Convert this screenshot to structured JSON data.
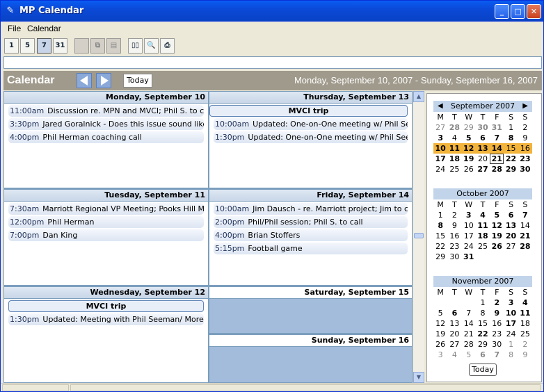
{
  "window": {
    "title": "MP Calendar"
  },
  "menu": [
    "File",
    "Calendar"
  ],
  "toolbar": {
    "view_buttons": [
      "1",
      "5",
      "7",
      "31"
    ]
  },
  "calendar": {
    "heading": "Calendar",
    "today_label": "Today",
    "range": "Monday, September 10, 2007 - Sunday, September 16, 2007"
  },
  "days": [
    {
      "header": "Monday, September 10",
      "events": [
        {
          "time": "11:00am",
          "text": "Discussion re. MPN and MVCI; Phil S. to call"
        },
        {
          "time": "3:30pm",
          "text": "Jared Goralnick - Does this issue sound like s"
        },
        {
          "time": "4:00pm",
          "text": "Phil Herman coaching call"
        }
      ]
    },
    {
      "header": "Tuesday, September 11",
      "events": [
        {
          "time": "7:30am",
          "text": "Marriott Regional VP Meeting; Pooks Hill Ma"
        },
        {
          "time": "12:00pm",
          "text": "Phil Herman"
        },
        {
          "time": "7:00pm",
          "text": "Dan King"
        }
      ]
    },
    {
      "header": "Wednesday, September 12",
      "allday": "MVCI trip",
      "events": [
        {
          "time": "1:30pm",
          "text": "Updated: Meeting with Phil Seeman/ More P"
        }
      ]
    },
    {
      "header": "Thursday, September 13",
      "allday": "MVCI trip",
      "events": [
        {
          "time": "10:00am",
          "text": "Updated: One-on-One meeting w/ Phil Seer"
        },
        {
          "time": "1:30pm",
          "text": "Updated: One-on-One meeting w/ Phil Seem"
        }
      ]
    },
    {
      "header": "Friday, September 14",
      "events": [
        {
          "time": "10:00am",
          "text": "Jim Dausch - re. Marriott project; Jim to call"
        },
        {
          "time": "2:00pm",
          "text": "Phil/Phil session; Phil S. to call"
        },
        {
          "time": "4:00pm",
          "text": "Brian Stoffers"
        },
        {
          "time": "5:15pm",
          "text": "Football game"
        }
      ]
    },
    {
      "header": "Saturday, September 15",
      "events": []
    },
    {
      "header": "Sunday, September 16",
      "events": []
    }
  ],
  "mini_calendar": {
    "dow": [
      "M",
      "T",
      "W",
      "T",
      "F",
      "S",
      "S"
    ],
    "months": [
      {
        "title": "September 2007",
        "weeks": [
          [
            "27",
            "28",
            "29",
            "30",
            "31",
            "1",
            "2"
          ],
          [
            "3",
            "4",
            "5",
            "6",
            "7",
            "8",
            "9"
          ],
          [
            "10",
            "11",
            "12",
            "13",
            "14",
            "15",
            "16"
          ],
          [
            "17",
            "18",
            "19",
            "20",
            "21",
            "22",
            "23"
          ],
          [
            "24",
            "25",
            "26",
            "27",
            "28",
            "29",
            "30"
          ]
        ]
      },
      {
        "title": "October 2007",
        "weeks": [
          [
            "1",
            "2",
            "3",
            "4",
            "5",
            "6",
            "7"
          ],
          [
            "8",
            "9",
            "10",
            "11",
            "12",
            "13",
            "14"
          ],
          [
            "15",
            "16",
            "17",
            "18",
            "19",
            "20",
            "21"
          ],
          [
            "22",
            "23",
            "24",
            "25",
            "26",
            "27",
            "28"
          ],
          [
            "29",
            "30",
            "31",
            "",
            "",
            "",
            ""
          ]
        ]
      },
      {
        "title": "November 2007",
        "weeks": [
          [
            "",
            "",
            "",
            "1",
            "2",
            "3",
            "4"
          ],
          [
            "5",
            "6",
            "7",
            "8",
            "9",
            "10",
            "11"
          ],
          [
            "12",
            "13",
            "14",
            "15",
            "16",
            "17",
            "18"
          ],
          [
            "19",
            "20",
            "21",
            "22",
            "23",
            "24",
            "25"
          ],
          [
            "26",
            "27",
            "28",
            "29",
            "30",
            "1",
            "2"
          ],
          [
            "3",
            "4",
            "5",
            "6",
            "7",
            "8",
            "9"
          ]
        ]
      }
    ],
    "today_label": "Today"
  }
}
